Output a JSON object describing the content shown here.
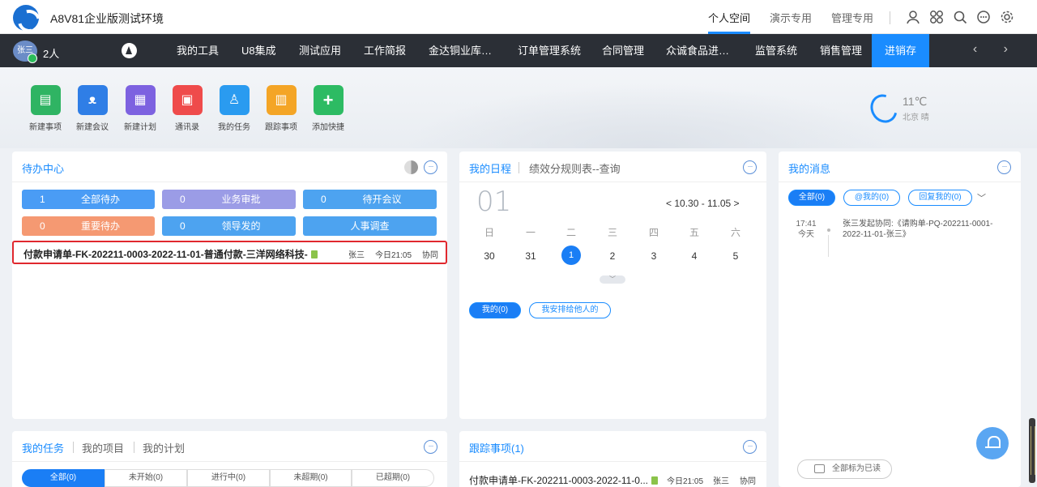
{
  "app": {
    "title": "A8V81企业版测试环境"
  },
  "top_links": [
    "个人空间",
    "演示专用",
    "管理专用"
  ],
  "user": {
    "avatar_text": "张三",
    "count": "2人"
  },
  "nav": {
    "items": [
      "我的工具",
      "U8集成",
      "测试应用",
      "工作简报",
      "金达铜业库…",
      "订单管理系统",
      "合同管理",
      "众诚食品进…",
      "监管系统",
      "销售管理"
    ],
    "active": "进销存",
    "arrows": "‹ ›"
  },
  "shortcuts": [
    {
      "label": "新建事项",
      "color": "#2fb463",
      "glyph": "▤"
    },
    {
      "label": "新建会议",
      "color": "#2f7ee6",
      "glyph": "ᴥ"
    },
    {
      "label": "新建计划",
      "color": "#7d62e0",
      "glyph": "▦"
    },
    {
      "label": "通讯录",
      "color": "#ef4b4b",
      "glyph": "▣"
    },
    {
      "label": "我的任务",
      "color": "#2a9bf0",
      "glyph": "♙"
    },
    {
      "label": "跟踪事项",
      "color": "#f4a526",
      "glyph": "▥"
    },
    {
      "label": "添加快捷",
      "color": "#2dbb63",
      "glyph": "+"
    }
  ],
  "weather": {
    "temp": "11℃",
    "city": "北京 晴"
  },
  "todo": {
    "title": "待办中心",
    "more": "···",
    "buttons": [
      {
        "num": "1",
        "label": "全部待办"
      },
      {
        "num": "0",
        "label": "业务审批"
      },
      {
        "num": "0",
        "label": "待开会议"
      },
      {
        "num": "0",
        "label": "重要待办"
      },
      {
        "num": "0",
        "label": "领导发的"
      },
      {
        "num": "",
        "label": "人事调查"
      }
    ],
    "row": {
      "title": "付款申请单-FK-202211-0003-2022-11-01-普通付款-三洋网络科技-",
      "person": "张三",
      "time": "今日21:05",
      "type": "协同"
    }
  },
  "schedule": {
    "tab_active": "我的日程",
    "tab_other": "绩效分规则表--查询",
    "big_day": "01",
    "range": "<  10.30 - 11.05  >",
    "weekdays": [
      "日",
      "一",
      "二",
      "三",
      "四",
      "五",
      "六"
    ],
    "days": [
      "30",
      "31",
      "1",
      "2",
      "3",
      "4",
      "5"
    ],
    "expand": "﹀",
    "pills": [
      "我的(0)",
      "我安排给他人的"
    ]
  },
  "messages": {
    "title": "我的消息",
    "pills": [
      "全部(0)",
      "@我的(0)",
      "回复我的(0)"
    ],
    "dropdown": "﹀",
    "item": {
      "time": "17:41",
      "day": "今天",
      "text": "张三发起协同:《请购单-PQ-202211-0001-2022-11-01-张三》"
    },
    "mark_read": "全部标为已读"
  },
  "tasks": {
    "tabs": [
      "我的任务",
      "我的项目",
      "我的计划"
    ],
    "segments": [
      "全部(0)",
      "未开始(0)",
      "进行中(0)",
      "未超期(0)",
      "已超期(0)"
    ]
  },
  "tracking": {
    "title": "跟踪事项(1)",
    "row": {
      "title": "付款申请单-FK-202211-0003-2022-11-0...",
      "time": "今日21:05",
      "person": "张三",
      "type": "协同"
    }
  }
}
